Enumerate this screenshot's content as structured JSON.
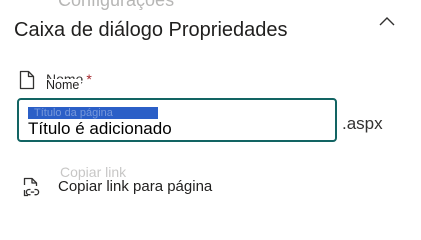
{
  "panel": {
    "ghost_title": "Configurações",
    "title": "Caixa de diálogo Propriedades"
  },
  "name_field": {
    "ghost_label": "Nome",
    "required_mark": "*",
    "floating_label": "Nome",
    "selected_ghost_text": "Título da página",
    "value": "Título é adicionado",
    "suffix": ".aspx"
  },
  "copy_link": {
    "ghost_text": "Copiar link",
    "label": "Copiar link para página"
  },
  "icons": {
    "collapse": "chevron-up-icon",
    "name": "page-document-icon",
    "copy_link": "page-link-icon"
  },
  "colors": {
    "field_border": "#126463",
    "selection": "#2b5fc7",
    "required": "#a4262c"
  }
}
